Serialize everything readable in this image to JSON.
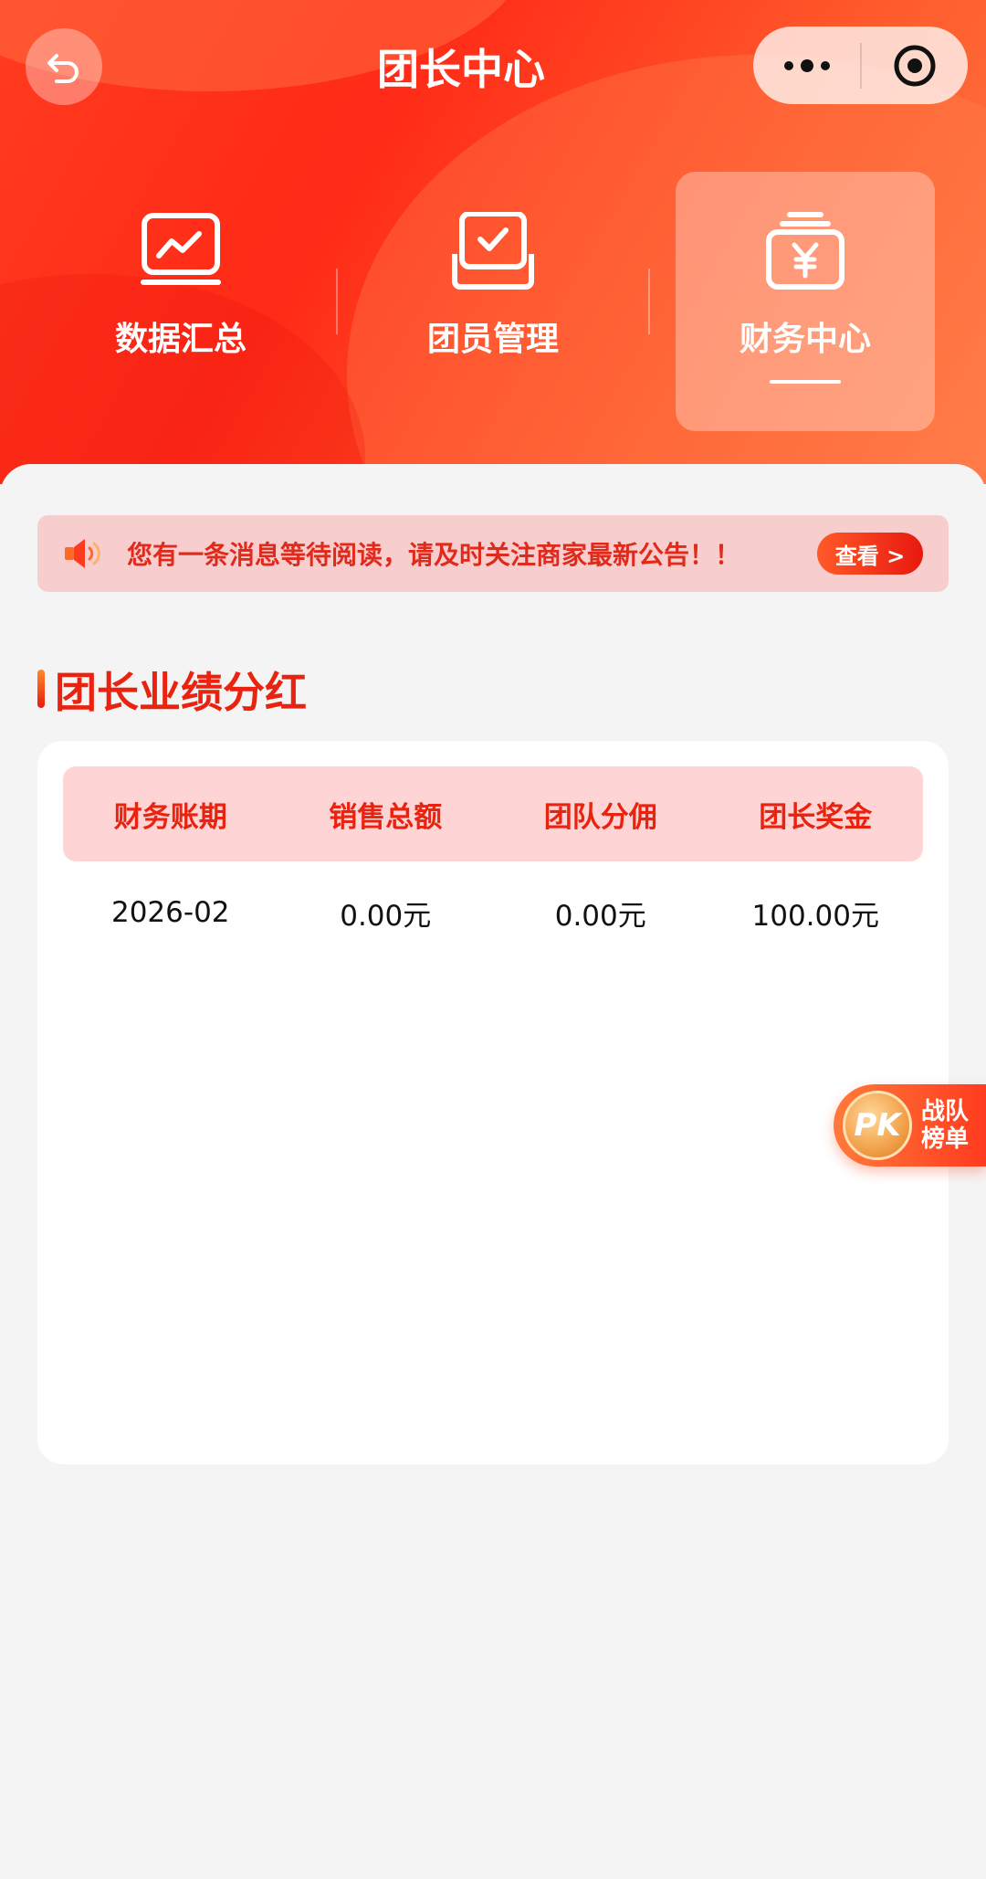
{
  "header": {
    "title": "团长中心",
    "icons": {
      "back": "back-arrow-icon",
      "more": "more-dots-icon",
      "target": "target-circle-icon"
    }
  },
  "nav": {
    "items": [
      {
        "label": "数据汇总",
        "icon": "chart-monitor-icon",
        "active": false
      },
      {
        "label": "团员管理",
        "icon": "check-tray-icon",
        "active": false
      },
      {
        "label": "财务中心",
        "icon": "yen-wallet-icon",
        "active": true
      }
    ]
  },
  "notice": {
    "text": "您有一条消息等待阅读，请及时关注商家最新公告！！",
    "button": "查看 >",
    "icon": "speaker-icon"
  },
  "section": {
    "title": "团长业绩分红"
  },
  "table": {
    "headers": [
      "财务账期",
      "销售总额",
      "团队分佣",
      "团长奖金"
    ],
    "rows": [
      [
        "2026-02",
        "0.00元",
        "0.00元",
        "100.00元"
      ]
    ]
  },
  "float": {
    "badge": "PK",
    "line1": "战队",
    "line2": "榜单"
  },
  "colors": {
    "brand": "#ff2a17",
    "accent_text": "#e8230f",
    "notice_bg": "#f8cdcd",
    "thead_bg": "#ffd4d4"
  }
}
